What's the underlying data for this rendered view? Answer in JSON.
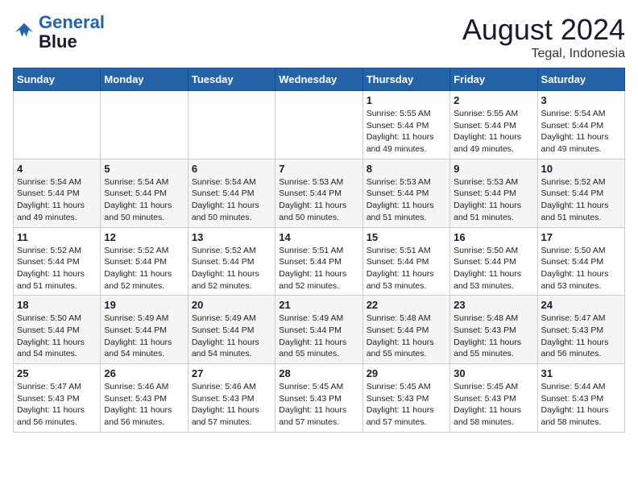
{
  "logo": {
    "line1": "General",
    "line2": "Blue"
  },
  "header": {
    "month_year": "August 2024",
    "location": "Tegal, Indonesia"
  },
  "weekdays": [
    "Sunday",
    "Monday",
    "Tuesday",
    "Wednesday",
    "Thursday",
    "Friday",
    "Saturday"
  ],
  "weeks": [
    [
      {
        "day": "",
        "info": ""
      },
      {
        "day": "",
        "info": ""
      },
      {
        "day": "",
        "info": ""
      },
      {
        "day": "",
        "info": ""
      },
      {
        "day": "1",
        "info": "Sunrise: 5:55 AM\nSunset: 5:44 PM\nDaylight: 11 hours\nand 49 minutes."
      },
      {
        "day": "2",
        "info": "Sunrise: 5:55 AM\nSunset: 5:44 PM\nDaylight: 11 hours\nand 49 minutes."
      },
      {
        "day": "3",
        "info": "Sunrise: 5:54 AM\nSunset: 5:44 PM\nDaylight: 11 hours\nand 49 minutes."
      }
    ],
    [
      {
        "day": "4",
        "info": "Sunrise: 5:54 AM\nSunset: 5:44 PM\nDaylight: 11 hours\nand 49 minutes."
      },
      {
        "day": "5",
        "info": "Sunrise: 5:54 AM\nSunset: 5:44 PM\nDaylight: 11 hours\nand 50 minutes."
      },
      {
        "day": "6",
        "info": "Sunrise: 5:54 AM\nSunset: 5:44 PM\nDaylight: 11 hours\nand 50 minutes."
      },
      {
        "day": "7",
        "info": "Sunrise: 5:53 AM\nSunset: 5:44 PM\nDaylight: 11 hours\nand 50 minutes."
      },
      {
        "day": "8",
        "info": "Sunrise: 5:53 AM\nSunset: 5:44 PM\nDaylight: 11 hours\nand 51 minutes."
      },
      {
        "day": "9",
        "info": "Sunrise: 5:53 AM\nSunset: 5:44 PM\nDaylight: 11 hours\nand 51 minutes."
      },
      {
        "day": "10",
        "info": "Sunrise: 5:52 AM\nSunset: 5:44 PM\nDaylight: 11 hours\nand 51 minutes."
      }
    ],
    [
      {
        "day": "11",
        "info": "Sunrise: 5:52 AM\nSunset: 5:44 PM\nDaylight: 11 hours\nand 51 minutes."
      },
      {
        "day": "12",
        "info": "Sunrise: 5:52 AM\nSunset: 5:44 PM\nDaylight: 11 hours\nand 52 minutes."
      },
      {
        "day": "13",
        "info": "Sunrise: 5:52 AM\nSunset: 5:44 PM\nDaylight: 11 hours\nand 52 minutes."
      },
      {
        "day": "14",
        "info": "Sunrise: 5:51 AM\nSunset: 5:44 PM\nDaylight: 11 hours\nand 52 minutes."
      },
      {
        "day": "15",
        "info": "Sunrise: 5:51 AM\nSunset: 5:44 PM\nDaylight: 11 hours\nand 53 minutes."
      },
      {
        "day": "16",
        "info": "Sunrise: 5:50 AM\nSunset: 5:44 PM\nDaylight: 11 hours\nand 53 minutes."
      },
      {
        "day": "17",
        "info": "Sunrise: 5:50 AM\nSunset: 5:44 PM\nDaylight: 11 hours\nand 53 minutes."
      }
    ],
    [
      {
        "day": "18",
        "info": "Sunrise: 5:50 AM\nSunset: 5:44 PM\nDaylight: 11 hours\nand 54 minutes."
      },
      {
        "day": "19",
        "info": "Sunrise: 5:49 AM\nSunset: 5:44 PM\nDaylight: 11 hours\nand 54 minutes."
      },
      {
        "day": "20",
        "info": "Sunrise: 5:49 AM\nSunset: 5:44 PM\nDaylight: 11 hours\nand 54 minutes."
      },
      {
        "day": "21",
        "info": "Sunrise: 5:49 AM\nSunset: 5:44 PM\nDaylight: 11 hours\nand 55 minutes."
      },
      {
        "day": "22",
        "info": "Sunrise: 5:48 AM\nSunset: 5:44 PM\nDaylight: 11 hours\nand 55 minutes."
      },
      {
        "day": "23",
        "info": "Sunrise: 5:48 AM\nSunset: 5:43 PM\nDaylight: 11 hours\nand 55 minutes."
      },
      {
        "day": "24",
        "info": "Sunrise: 5:47 AM\nSunset: 5:43 PM\nDaylight: 11 hours\nand 56 minutes."
      }
    ],
    [
      {
        "day": "25",
        "info": "Sunrise: 5:47 AM\nSunset: 5:43 PM\nDaylight: 11 hours\nand 56 minutes."
      },
      {
        "day": "26",
        "info": "Sunrise: 5:46 AM\nSunset: 5:43 PM\nDaylight: 11 hours\nand 56 minutes."
      },
      {
        "day": "27",
        "info": "Sunrise: 5:46 AM\nSunset: 5:43 PM\nDaylight: 11 hours\nand 57 minutes."
      },
      {
        "day": "28",
        "info": "Sunrise: 5:45 AM\nSunset: 5:43 PM\nDaylight: 11 hours\nand 57 minutes."
      },
      {
        "day": "29",
        "info": "Sunrise: 5:45 AM\nSunset: 5:43 PM\nDaylight: 11 hours\nand 57 minutes."
      },
      {
        "day": "30",
        "info": "Sunrise: 5:45 AM\nSunset: 5:43 PM\nDaylight: 11 hours\nand 58 minutes."
      },
      {
        "day": "31",
        "info": "Sunrise: 5:44 AM\nSunset: 5:43 PM\nDaylight: 11 hours\nand 58 minutes."
      }
    ]
  ]
}
